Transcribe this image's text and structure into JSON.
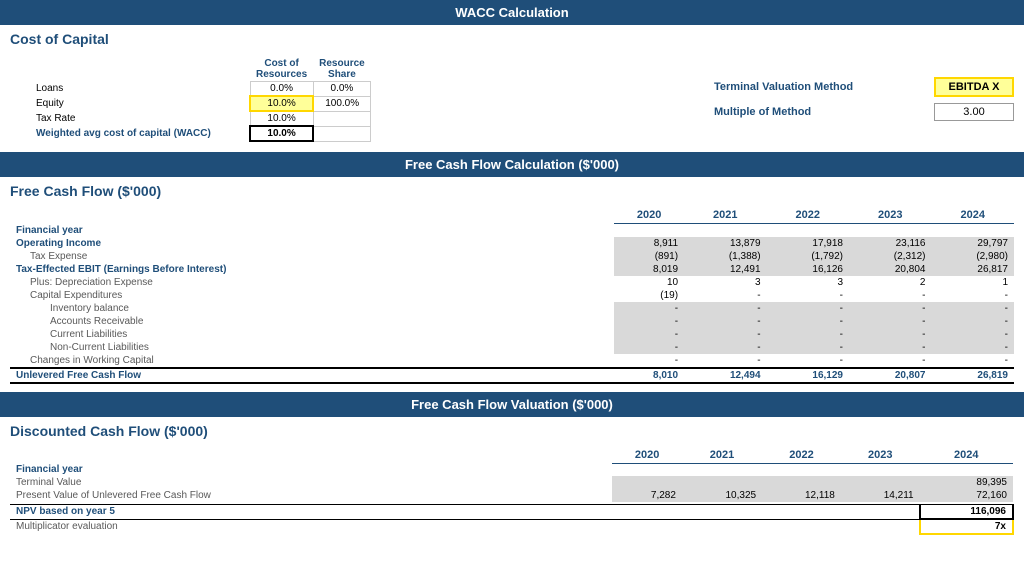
{
  "page": {
    "wacc_header": "WACC Calculation",
    "wacc_section_title": "Cost of Capital",
    "col_headers": {
      "cost_of_resources": "Cost of",
      "cost_of_resources2": "Resources",
      "resource_share": "Resource",
      "resource_share2": "Share"
    },
    "wacc_rows": [
      {
        "label": "Loans",
        "cost": "0.0%",
        "share": "0.0%",
        "cost_style": "plain",
        "share_style": "plain"
      },
      {
        "label": "Equity",
        "cost": "10.0%",
        "share": "100.0%",
        "cost_style": "yellow",
        "share_style": "plain"
      },
      {
        "label": "Tax Rate",
        "cost": "10.0%",
        "share": "",
        "cost_style": "plain",
        "share_style": ""
      },
      {
        "label": "Weighted avg cost of capital (WACC)",
        "cost": "10.0%",
        "share": "",
        "cost_style": "bold",
        "share_style": "",
        "label_style": "bold"
      }
    ],
    "terminal_valuation_label": "Terminal Valuation Method",
    "multiple_of_method_label": "Multiple of Method",
    "terminal_value": "EBITDA X",
    "multiple_value": "3.00",
    "fcf_header": "Free Cash Flow Calculation ($'000)",
    "fcf_section_title": "Free Cash Flow ($'000)",
    "years": [
      "2020",
      "2021",
      "2022",
      "2023",
      "2024"
    ],
    "fcf_rows": [
      {
        "label": "Financial year",
        "values": [
          "",
          "",
          "",
          "",
          ""
        ],
        "style": "header"
      },
      {
        "label": "Operating Income",
        "values": [
          "8,911",
          "13,879",
          "17,918",
          "23,116",
          "29,797"
        ],
        "style": "bold-data"
      },
      {
        "label": "Tax Expense",
        "values": [
          "(891)",
          "(1,388)",
          "(1,792)",
          "(2,312)",
          "(2,980)"
        ],
        "style": "indent1-data"
      },
      {
        "label": "Tax-Effected EBIT (Earnings Before Interest)",
        "values": [
          "8,019",
          "12,491",
          "16,126",
          "20,804",
          "26,817"
        ],
        "style": "bold-data"
      },
      {
        "label": "Plus: Depreciation Expense",
        "values": [
          "10",
          "3",
          "3",
          "2",
          "1"
        ],
        "style": "indent1-white"
      },
      {
        "label": "Capital Expenditures",
        "values": [
          "(19)",
          "-",
          "-",
          "-",
          "-"
        ],
        "style": "indent1-white"
      },
      {
        "label": "Inventory balance",
        "values": [
          "-",
          "-",
          "-",
          "-",
          "-"
        ],
        "style": "indent2-data"
      },
      {
        "label": "Accounts Receivable",
        "values": [
          "-",
          "-",
          "-",
          "-",
          "-"
        ],
        "style": "indent2-data"
      },
      {
        "label": "Current Liabilities",
        "values": [
          "-",
          "-",
          "-",
          "-",
          "-"
        ],
        "style": "indent2-data"
      },
      {
        "label": "Non-Current Liabilities",
        "values": [
          "-",
          "-",
          "-",
          "-",
          "-"
        ],
        "style": "indent2-data"
      },
      {
        "label": "Changes in Working Capital",
        "values": [
          "-",
          "-",
          "-",
          "-",
          "-"
        ],
        "style": "indent1-white"
      },
      {
        "label": "Unlevered Free Cash Flow",
        "values": [
          "8,010",
          "12,494",
          "16,129",
          "20,807",
          "26,819"
        ],
        "style": "total"
      }
    ],
    "dcf_header": "Free Cash Flow Valuation ($'000)",
    "dcf_section_title": "Discounted Cash Flow ($'000)",
    "dcf_rows": [
      {
        "label": "Financial year",
        "values": [
          "",
          "",
          "",
          "",
          ""
        ],
        "style": "header"
      },
      {
        "label": "Terminal Value",
        "values": [
          "",
          "",
          "",
          "",
          "89,395"
        ],
        "style": "data"
      },
      {
        "label": "Present Value of Unlevered Free Cash Flow",
        "values": [
          "7,282",
          "10,325",
          "12,118",
          "14,211",
          "72,160"
        ],
        "style": "data"
      },
      {
        "label": "",
        "values": [
          "",
          "",
          "",
          "",
          ""
        ],
        "style": "spacer"
      },
      {
        "label": "NPV based on year 5",
        "values": [
          "",
          "",
          "",
          "",
          "116,096"
        ],
        "style": "npv-bold"
      },
      {
        "label": "Multiplicator evaluation",
        "values": [
          "",
          "",
          "",
          "",
          "7x"
        ],
        "style": "npv-yellow"
      }
    ]
  }
}
